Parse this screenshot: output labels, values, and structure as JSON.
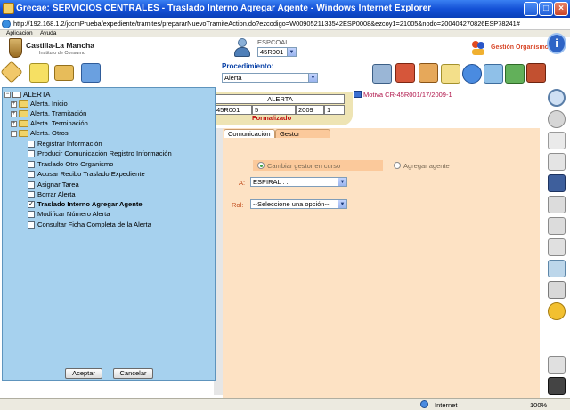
{
  "window": {
    "title": "Grecae: SERVICIOS CENTRALES - Traslado Interno Agregar Agente - Windows Internet Explorer",
    "url": "http://192.168.1.2/jccmPrueba/expediente/tramites/prepararNuevoTramiteAction.do?ezcodigo=W0090521133542ESP0008&ezcoy1=21005&nodo=200404270826ESP78241#"
  },
  "menubar": {
    "items": [
      "Aplicación",
      "Ayuda"
    ]
  },
  "header": {
    "logo_title": "Castilla-La Mancha",
    "logo_subtitle": "Instituto de Consumo",
    "user_label": "ESPCOAL",
    "user_select": "45R001",
    "org_label": "Gestión Organismo"
  },
  "toolbar": {
    "procedimiento_label": "Procedimiento:",
    "procedimiento_value": "Alerta"
  },
  "tree": {
    "root": "ALERTA",
    "nodes": [
      {
        "label": "Alerta. Inicio",
        "expander": "+"
      },
      {
        "label": "Alerta. Tramitación",
        "expander": "+"
      },
      {
        "label": "Alerta. Terminación",
        "expander": "+"
      },
      {
        "label": "Alerta. Otros",
        "expander": "−"
      }
    ],
    "items": [
      {
        "label": "Registrar Información",
        "checked": false
      },
      {
        "label": "Producir Comunicación Registro Información",
        "checked": false
      },
      {
        "label": "Traslado Otro Organismo",
        "checked": false
      },
      {
        "label": "Acusar Recibo Traslado Expediente",
        "checked": false
      },
      {
        "label": "Asignar Tarea",
        "checked": false
      },
      {
        "label": "Borrar Alerta",
        "checked": false
      },
      {
        "label": "Traslado Interno Agregar Agente",
        "checked": true
      },
      {
        "label": "Modificar Número Alerta",
        "checked": false
      },
      {
        "label": "Consultar Ficha Completa de la Alerta",
        "checked": false
      }
    ],
    "accept_label": "Aceptar",
    "cancel_label": "Cancelar"
  },
  "alert": {
    "header": "ALERTA",
    "fields": [
      "45R001",
      "5",
      "2009",
      "1"
    ],
    "status": "Formalizado",
    "motiva": "Motiva CR-45R001/17/2009-1"
  },
  "tabs": [
    "Comunicación",
    "Gestor"
  ],
  "gestor": {
    "option_change": "Cambiar gestor en curso",
    "option_add": "Agregar agente",
    "a_label": "A:",
    "a_value": "ESPIRAL . .",
    "rol_label": "Rol:",
    "rol_value": "--Seleccione una opción--"
  },
  "status": {
    "zone": "Internet",
    "zoom": "100%"
  },
  "colors": {
    "tree_bg": "#a6d1ee",
    "form_bg": "#fde2c4",
    "accent_red": "#c01010",
    "title_blue": "#1451d6"
  }
}
